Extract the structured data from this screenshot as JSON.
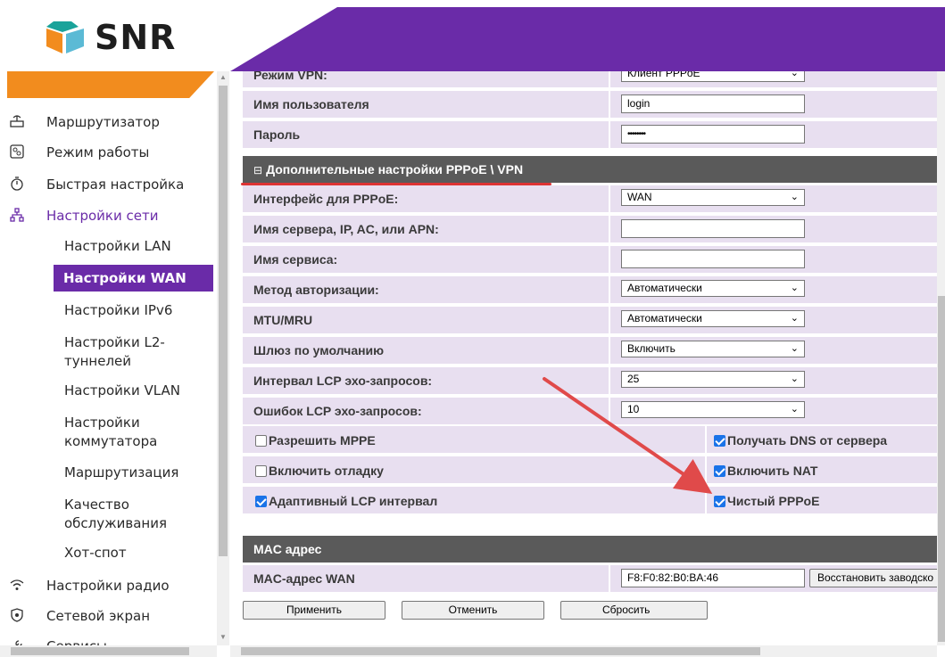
{
  "brand": {
    "name": "SNR",
    "purple": "#6a2ba8",
    "orange": "#f28c1e"
  },
  "sidebar": {
    "items": [
      {
        "label": "Маршрутизатор",
        "icon": "router-icon"
      },
      {
        "label": "Режим работы",
        "icon": "mode-icon"
      },
      {
        "label": "Быстрая настройка",
        "icon": "wizard-icon"
      },
      {
        "label": "Настройки сети",
        "icon": "network-icon"
      },
      {
        "label": "Настройки радио",
        "icon": "wifi-icon"
      },
      {
        "label": "Сетевой экран",
        "icon": "shield-icon"
      },
      {
        "label": "Сервисы",
        "icon": "services-icon"
      }
    ],
    "sub": [
      "Настройки LAN",
      "Настройки WAN",
      "Настройки IPv6",
      "Настройки L2-\nтуннелей",
      "Настройки VLAN",
      "Настройки\nкоммутатора",
      "Маршрутизация",
      "Качество\nобслуживания",
      "Хот-спот"
    ]
  },
  "main": {
    "vpn_mode": {
      "label": "Режим VPN:",
      "value": "Клиент PPPoE"
    },
    "username": {
      "label": "Имя пользователя",
      "value": "login"
    },
    "password": {
      "label": "Пароль",
      "value": "••••••••"
    },
    "section_pppoe": "Дополнительные настройки PPPoE \\ VPN",
    "fields": [
      {
        "label": "Интерфейс для PPPoE:",
        "type": "select",
        "value": "WAN"
      },
      {
        "label": "Имя сервера, IP, AC, или APN:",
        "type": "input",
        "value": ""
      },
      {
        "label": "Имя сервиса:",
        "type": "input",
        "value": ""
      },
      {
        "label": "Метод авторизации:",
        "type": "select",
        "value": "Автоматически"
      },
      {
        "label": "MTU/MRU",
        "type": "select",
        "value": "Автоматически"
      },
      {
        "label": "Шлюз по умолчанию",
        "type": "select",
        "value": "Включить"
      },
      {
        "label": "Интервал LCP эхо-запросов:",
        "type": "select",
        "value": "25"
      },
      {
        "label": "Ошибок LCP эхо-запросов:",
        "type": "select",
        "value": "10"
      }
    ],
    "checkboxes": [
      {
        "left": {
          "label": "Разрешить MPPE",
          "checked": false
        },
        "right": {
          "label": "Получать DNS от сервера",
          "checked": true
        }
      },
      {
        "left": {
          "label": "Включить отладку",
          "checked": false
        },
        "right": {
          "label": "Включить NAT",
          "checked": true
        }
      },
      {
        "left": {
          "label": "Адаптивный LCP интервал",
          "checked": true
        },
        "right": {
          "label": "Чистый PPPoE",
          "checked": true
        }
      }
    ],
    "section_mac": "MAC адрес",
    "mac": {
      "label": "MAC-адрес WAN",
      "value": "F8:F0:82:B0:BA:46",
      "restore_button": "Восстановить заводско"
    },
    "buttons": {
      "apply": "Применить",
      "cancel": "Отменить",
      "reset": "Сбросить"
    }
  }
}
